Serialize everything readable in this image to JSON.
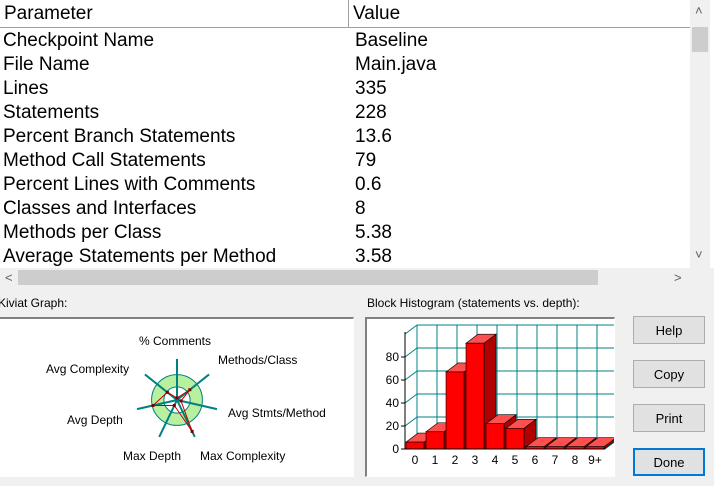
{
  "table": {
    "headers": {
      "parameter": "Parameter",
      "value": "Value"
    },
    "rows": [
      {
        "parameter": "Checkpoint Name",
        "value": "Baseline"
      },
      {
        "parameter": "File Name",
        "value": "Main.java"
      },
      {
        "parameter": "Lines",
        "value": "335"
      },
      {
        "parameter": "Statements",
        "value": "228"
      },
      {
        "parameter": "Percent Branch Statements",
        "value": "13.6"
      },
      {
        "parameter": "Method Call Statements",
        "value": "79"
      },
      {
        "parameter": "Percent Lines with Comments",
        "value": "0.6"
      },
      {
        "parameter": "Classes and Interfaces",
        "value": "8"
      },
      {
        "parameter": "Methods per Class",
        "value": "5.38"
      },
      {
        "parameter": "Average Statements per Method",
        "value": "3.58"
      }
    ]
  },
  "kiviat": {
    "label": "Kiviat Graph:",
    "axes": [
      "% Comments",
      "Methods/Class",
      "Avg Stmts/Method",
      "Max Complexity",
      "Max Depth",
      "Avg Depth",
      "Avg Complexity"
    ],
    "values": [
      0.05,
      0.4,
      0.1,
      0.85,
      0.15,
      0.6,
      0.3
    ],
    "band_inner": 0.32,
    "band_outer": 0.62,
    "colors": {
      "band": "#b8f0a0",
      "spokes": "#008080",
      "polygon": "#c00000",
      "points": "#800000"
    }
  },
  "histogram": {
    "label": "Block Histogram (statements vs. depth):",
    "chart_data": {
      "type": "bar",
      "categories": [
        "0",
        "1",
        "2",
        "3",
        "4",
        "5",
        "6",
        "7",
        "8",
        "9+"
      ],
      "values": [
        6,
        15,
        67,
        92,
        22,
        18,
        2,
        2,
        2,
        2
      ],
      "ylim": [
        0,
        100
      ],
      "yticks": [
        0,
        20,
        40,
        60,
        80
      ],
      "grid": true,
      "colors": {
        "bar": "#ff0000",
        "grid": "#008080"
      }
    }
  },
  "buttons": {
    "help": "Help",
    "copy": "Copy",
    "print": "Print",
    "done": "Done"
  }
}
